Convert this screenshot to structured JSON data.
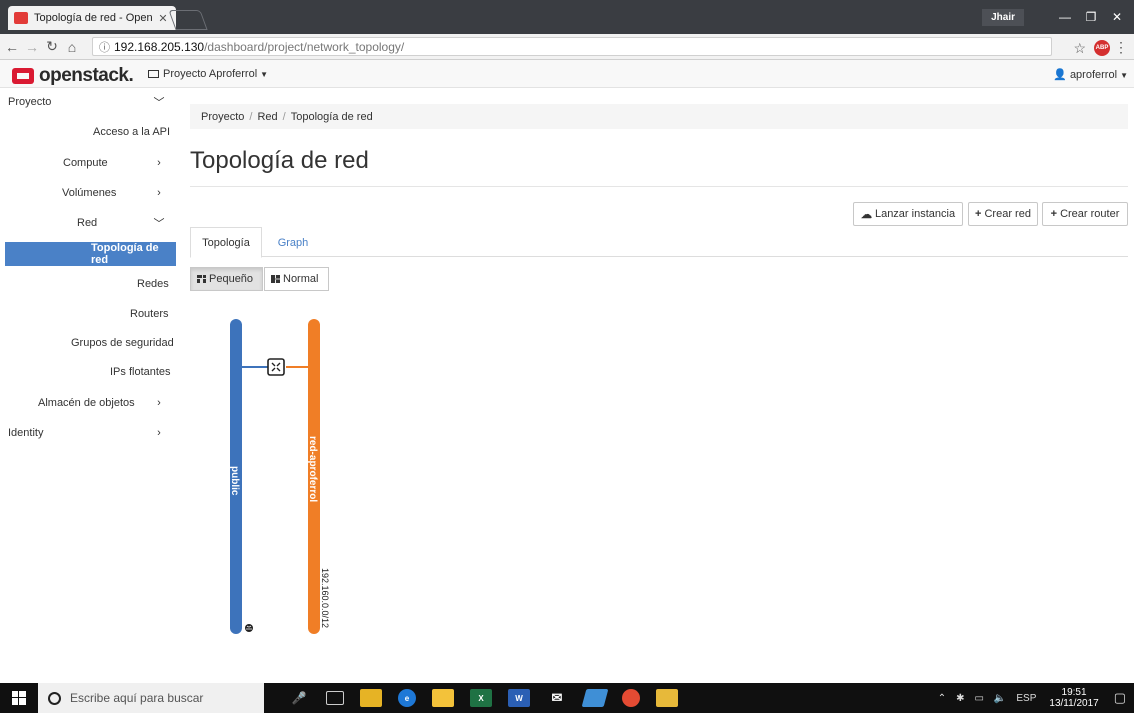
{
  "browser": {
    "tab_title": "Topología de red - Open",
    "window_user": "Jhair",
    "url_host": "192.168.205.130",
    "url_path": "/dashboard/project/network_topology/",
    "adblock_label": "ABP"
  },
  "header": {
    "brand": "openstack.",
    "project_dropdown": "Proyecto Aproferrol",
    "user_dropdown": "aproferrol"
  },
  "sidebar": {
    "items": [
      {
        "label": "Proyecto",
        "chevron": "down"
      },
      {
        "label": "Acceso a la API"
      },
      {
        "label": "Compute",
        "chevron": "right"
      },
      {
        "label": "Volúmenes",
        "chevron": "right"
      },
      {
        "label": "Red",
        "chevron": "down"
      },
      {
        "label": "Topología de red",
        "active": true
      },
      {
        "label": "Redes"
      },
      {
        "label": "Routers"
      },
      {
        "label": "Grupos de seguridad"
      },
      {
        "label": "IPs flotantes"
      },
      {
        "label": "Almacén de objetos",
        "chevron": "right"
      },
      {
        "label": "Identity",
        "chevron": "right"
      }
    ]
  },
  "breadcrumb": {
    "items": [
      "Proyecto",
      "Red",
      "Topología de red"
    ]
  },
  "page": {
    "title": "Topología de red"
  },
  "actions": {
    "launch_instance": "Lanzar instancia",
    "create_network": "Crear red",
    "create_router": "Crear router"
  },
  "tabs": {
    "topology": "Topología",
    "graph": "Graph"
  },
  "view_toggle": {
    "small": "Pequeño",
    "normal": "Normal",
    "selected": "small"
  },
  "topology": {
    "networks": [
      {
        "name": "public",
        "color": "#3d73bb"
      },
      {
        "name": "red-aproferrol",
        "color": "#f07e26",
        "subnet_label": "192.160.0.0/12"
      }
    ]
  },
  "taskbar": {
    "search_placeholder": "Escribe aquí para buscar",
    "language": "ESP",
    "time": "19:51",
    "date": "13/11/2017"
  }
}
